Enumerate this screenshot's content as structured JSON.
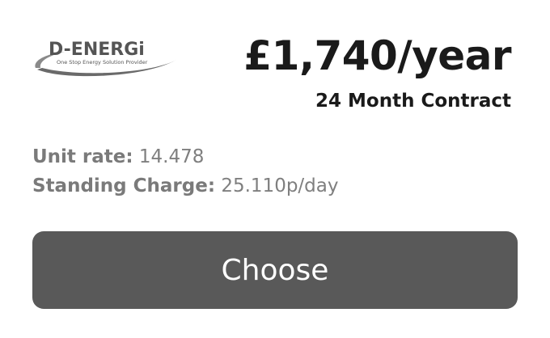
{
  "supplier": {
    "logo_name": "D-ENERGi",
    "logo_tagline": "One Stop Energy Solution Provider",
    "logo_color": "#555555"
  },
  "plan": {
    "price": "£1,740/year",
    "contract": "24 Month Contract",
    "unit_rate_label": "Unit rate:",
    "unit_rate_value": "14.478",
    "standing_charge_label": "Standing Charge:",
    "standing_charge_value": "25.110p/day"
  },
  "actions": {
    "choose_label": "Choose",
    "choose_color": "#595959"
  }
}
